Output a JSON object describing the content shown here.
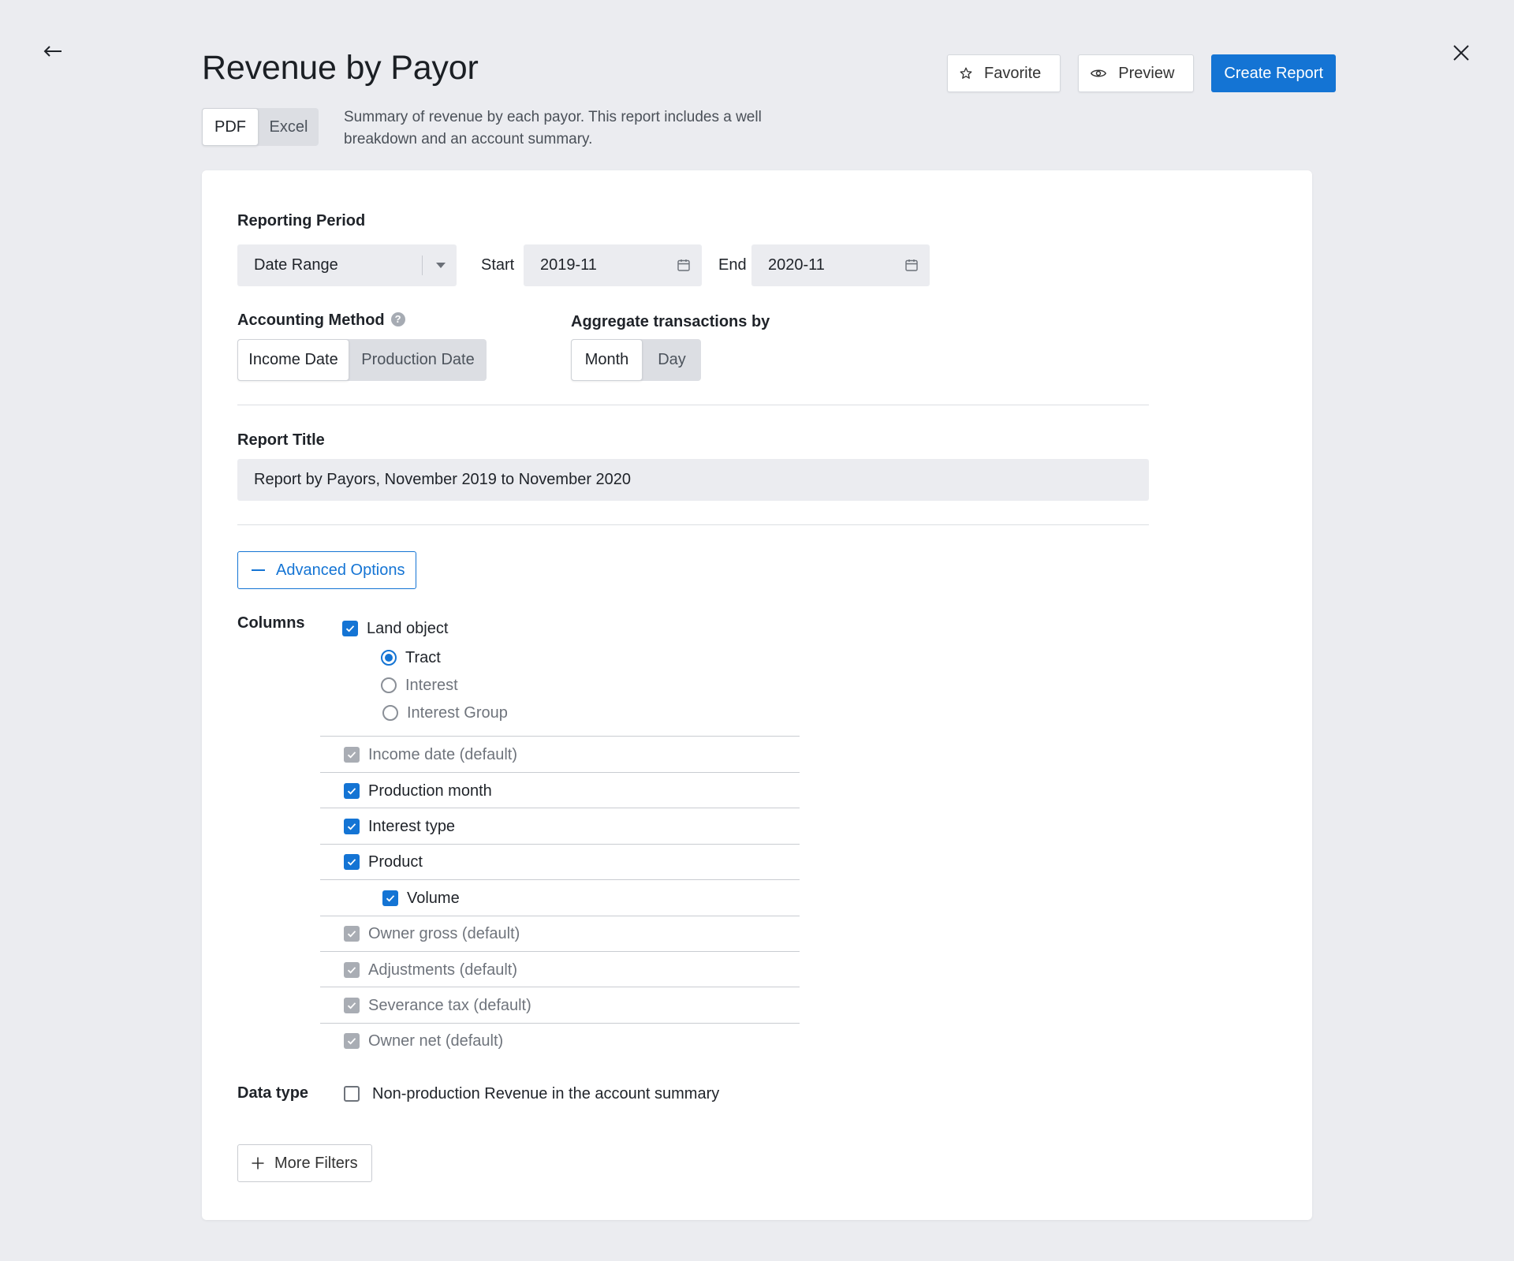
{
  "header": {
    "title": "Revenue by Payor",
    "description": "Summary of revenue by each payor. This report includes a well breakdown and an account summary.",
    "favorite_label": "Favorite",
    "preview_label": "Preview",
    "create_label": "Create Report",
    "accent": "#1474d4"
  },
  "format": {
    "options": [
      "PDF",
      "Excel"
    ],
    "selected": "PDF"
  },
  "reporting_period": {
    "label": "Reporting Period",
    "type_value": "Date Range",
    "start_label": "Start",
    "start_value": "2019-11",
    "end_label": "End",
    "end_value": "2020-11"
  },
  "accounting_method": {
    "label": "Accounting Method",
    "help": "?",
    "options": [
      "Income Date",
      "Production Date"
    ],
    "selected": "Income Date"
  },
  "aggregate": {
    "label": "Aggregate transactions by",
    "options": [
      "Month",
      "Day"
    ],
    "selected": "Month"
  },
  "report_title": {
    "label": "Report Title",
    "value": "Report by Payors, November 2019 to November 2020"
  },
  "advanced_options_label": "Advanced Options",
  "columns": {
    "label": "Columns",
    "land_object": {
      "label": "Land object",
      "checked": true
    },
    "land_object_radios": [
      {
        "label": "Tract",
        "selected": true
      },
      {
        "label": "Interest",
        "selected": false
      },
      {
        "label": "Interest Group",
        "selected": false
      }
    ],
    "items": [
      {
        "label": "Income date (default)",
        "state": "disabled"
      },
      {
        "label": "Production month",
        "state": "checked"
      },
      {
        "label": "Interest type",
        "state": "checked"
      },
      {
        "label": "Product",
        "state": "checked"
      },
      {
        "label": "Volume",
        "state": "checked"
      },
      {
        "label": "Owner gross (default)",
        "state": "disabled"
      },
      {
        "label": "Adjustments (default)",
        "state": "disabled"
      },
      {
        "label": "Severance tax (default)",
        "state": "disabled"
      },
      {
        "label": "Owner net (default)",
        "state": "disabled"
      }
    ]
  },
  "data_type": {
    "label": "Data type",
    "option_label": "Non-production Revenue in the account summary",
    "checked": false
  },
  "more_filters_label": "More Filters",
  "icons": [
    "back-arrow-icon",
    "close-icon",
    "star-icon",
    "eye-icon",
    "calendar-icon",
    "chevron-down-icon",
    "help-icon",
    "minus-icon",
    "plus-icon",
    "check-icon"
  ]
}
